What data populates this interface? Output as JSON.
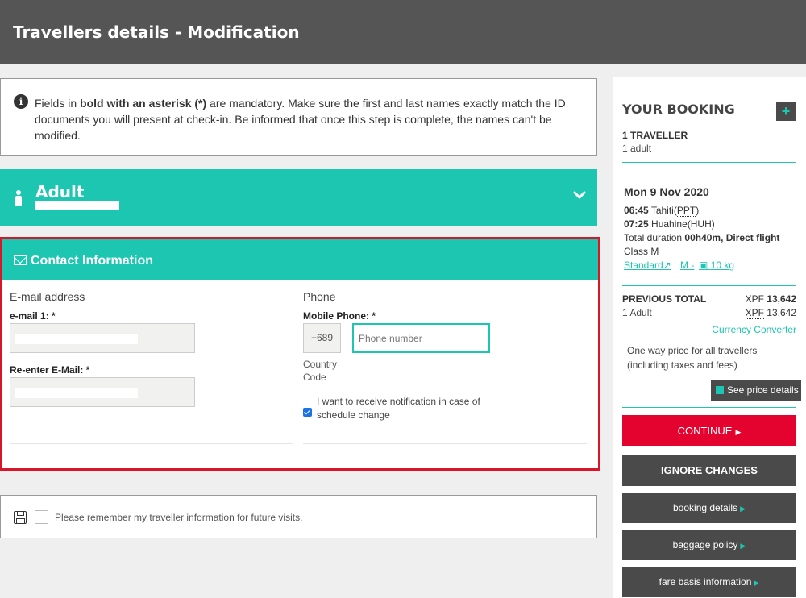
{
  "header": {
    "title": "Travellers details - Modification"
  },
  "info": {
    "prefix": "Fields in ",
    "bold": "bold with an asterisk (*)",
    "suffix": " are mandatory. Make sure the first and last names exactly match the ID documents you will present at check-in. Be informed that once this step is complete, the names can't be modified."
  },
  "adult": {
    "title": "Adult"
  },
  "contact": {
    "title": "Contact Information",
    "email_section": "E-mail address",
    "email1_label": "e-mail 1: *",
    "email2_label": "Re-enter E-Mail: *",
    "phone_section": "Phone",
    "mobile_label": "Mobile Phone: *",
    "country_code": "+689",
    "phone_placeholder": "Phone number",
    "country_code_label_1": "Country",
    "country_code_label_2": "Code",
    "notify_checked": true,
    "notify_text": "I want to receive notification in case of schedule change"
  },
  "remember": {
    "text": "Please remember my traveller information for future visits."
  },
  "sidebar": {
    "title": "YOUR BOOKING",
    "plus": "+",
    "travellers": "1 TRAVELLER",
    "travellers_detail": "1 adult",
    "date": "Mon 9 Nov 2020",
    "depart_time": "06:45",
    "depart_city": " Tahiti(",
    "depart_code": "PPT",
    "arrive_time": "07:25",
    "arrive_city": " Huahine(",
    "arrive_code": "HUH",
    "close_paren": ")",
    "duration_prefix": "Total duration ",
    "duration": "00h40m, Direct flight",
    "class": "Class M",
    "fare_link": "Standard",
    "class_link": "M -",
    "baggage_link": "10 kg",
    "previous_total_label": "PREVIOUS TOTAL",
    "previous_total_currency": "XPF",
    "previous_total_value": "13,642",
    "adult_label": "1 Adult",
    "adult_currency": "XPF",
    "adult_value": "13,642",
    "currency_converter": "Currency Converter",
    "one_way_note": "One way price for all travellers (including taxes and fees)",
    "see_price": "See price details",
    "continue": "CONTINUE",
    "ignore": "IGNORE CHANGES",
    "booking_details": "booking details",
    "baggage_policy": "baggage policy",
    "fare_basis": "fare basis information"
  },
  "colors": {
    "teal": "#1cc6b1",
    "red": "#e4032e",
    "dark": "#4a4a4a",
    "header": "#555555"
  }
}
